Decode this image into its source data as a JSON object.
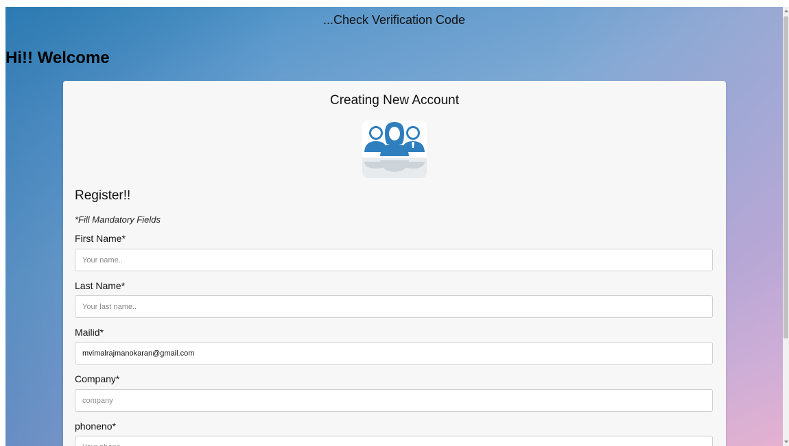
{
  "header": {
    "message": "...Check Verification Code",
    "welcome": "Hi!! Welcome"
  },
  "card": {
    "title": "Creating New Account",
    "logo_icon": "users-group-icon",
    "register_heading": "Register!!",
    "mandatory_note": "*Fill Mandatory Fields"
  },
  "form": {
    "first_name": {
      "label": "First Name*",
      "placeholder": "Your name..",
      "value": ""
    },
    "last_name": {
      "label": "Last Name*",
      "placeholder": "Your last name..",
      "value": ""
    },
    "mailid": {
      "label": "Mailid*",
      "placeholder": "",
      "value": "mvimalrajmanokaran@gmail.com"
    },
    "company": {
      "label": "Company*",
      "placeholder": "company",
      "value": ""
    },
    "phoneno": {
      "label": "phoneno*",
      "placeholder": "Your phone",
      "value": ""
    }
  },
  "colors": {
    "icon_blue": "#2f7fbf",
    "card_bg": "#f7f7f7"
  }
}
